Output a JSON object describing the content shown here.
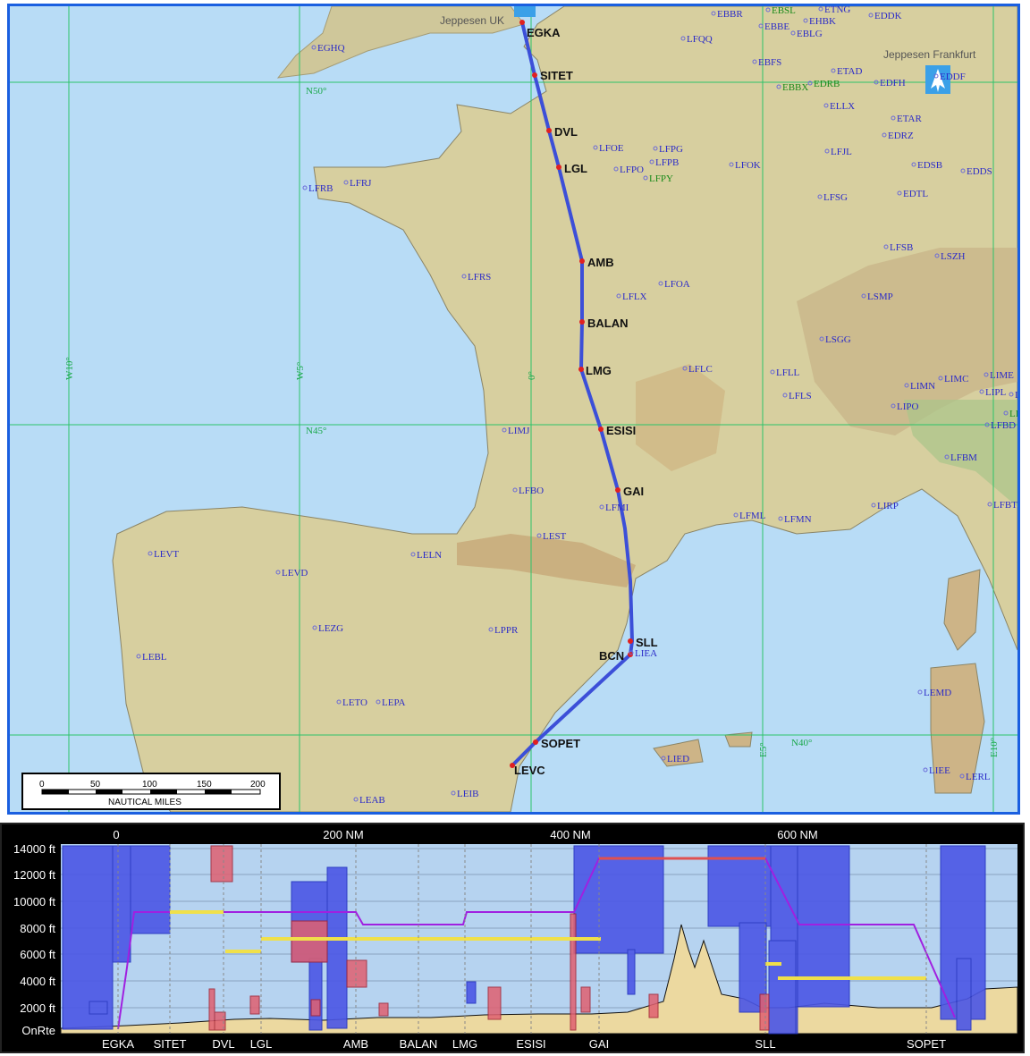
{
  "colors": {
    "sea": "#b8dcf6",
    "land": "#d9d1a2",
    "route": "#3c4fd8",
    "frame": "#1a5fe0",
    "grid": "#2cc36a"
  },
  "map": {
    "jeppesen_uk": "Jeppesen UK",
    "jeppesen_frankfurt": "Jeppesen Frankfurt",
    "grid_labels": [
      "N50°",
      "N45°",
      "N40°",
      "W10°",
      "W5°",
      "0°",
      "E5°",
      "E10°"
    ],
    "waypoints": [
      {
        "id": "EGKA"
      },
      {
        "id": "SITET"
      },
      {
        "id": "DVL"
      },
      {
        "id": "LGL"
      },
      {
        "id": "AMB"
      },
      {
        "id": "BALAN"
      },
      {
        "id": "LMG"
      },
      {
        "id": "ESISI"
      },
      {
        "id": "GAI"
      },
      {
        "id": "SLL"
      },
      {
        "id": "BCN"
      },
      {
        "id": "SOPET"
      },
      {
        "id": "LEVC"
      }
    ],
    "airports": [
      "EGHQ",
      "EBBR",
      "EBSL",
      "ETNG",
      "EDDK",
      "EBBE",
      "EHBK",
      "LFQQ",
      "EBLG",
      "EBFS",
      "ETAD",
      "EBBX",
      "EDRB",
      "EDFH",
      "EDDF",
      "ELLX",
      "ETAR",
      "EDRZ",
      "LFOE",
      "LFPG",
      "LFPB",
      "LFPO",
      "LFPY",
      "LFOK",
      "LFJL",
      "EDSB",
      "EDDS",
      "LFRB",
      "LFRJ",
      "LFSG",
      "EDTL",
      "LFSB",
      "LSZH",
      "LFRS",
      "LFLX",
      "LFOA",
      "LSMP",
      "LSGG",
      "LFLC",
      "LFLL",
      "LFLS",
      "LIMN",
      "LIMC",
      "LIME",
      "LIPL",
      "LIMF",
      "LIPO",
      "LIMS",
      "LFBD",
      "LIMJ",
      "LFBM",
      "LFBO",
      "LFMI",
      "LFML",
      "LFMN",
      "LIRP",
      "LFBT",
      "LEST",
      "LEVT",
      "LELN",
      "LEVD",
      "LEZG",
      "LPPR",
      "LEBL",
      "LIEA",
      "LEMD",
      "LETO",
      "LEPA",
      "LIED",
      "LIEE",
      "LERL",
      "LEAB",
      "LEIB"
    ],
    "scale_bar": {
      "ticks": [
        "0",
        "50",
        "100",
        "150",
        "200"
      ],
      "unit": "NAUTICAL MILES"
    }
  },
  "profile": {
    "y_labels": [
      "14000 ft",
      "12000 ft",
      "10000 ft",
      "8000 ft",
      "6000 ft",
      "4000 ft",
      "2000 ft",
      "OnRte"
    ],
    "x_labels": [
      "0",
      "200 NM",
      "400 NM",
      "600 NM"
    ],
    "waypoint_labels": [
      "EGKA",
      "SITET",
      "DVL",
      "LGL",
      "AMB",
      "BALAN",
      "LMG",
      "ESISI",
      "GAI",
      "SLL",
      "SOPET"
    ]
  }
}
